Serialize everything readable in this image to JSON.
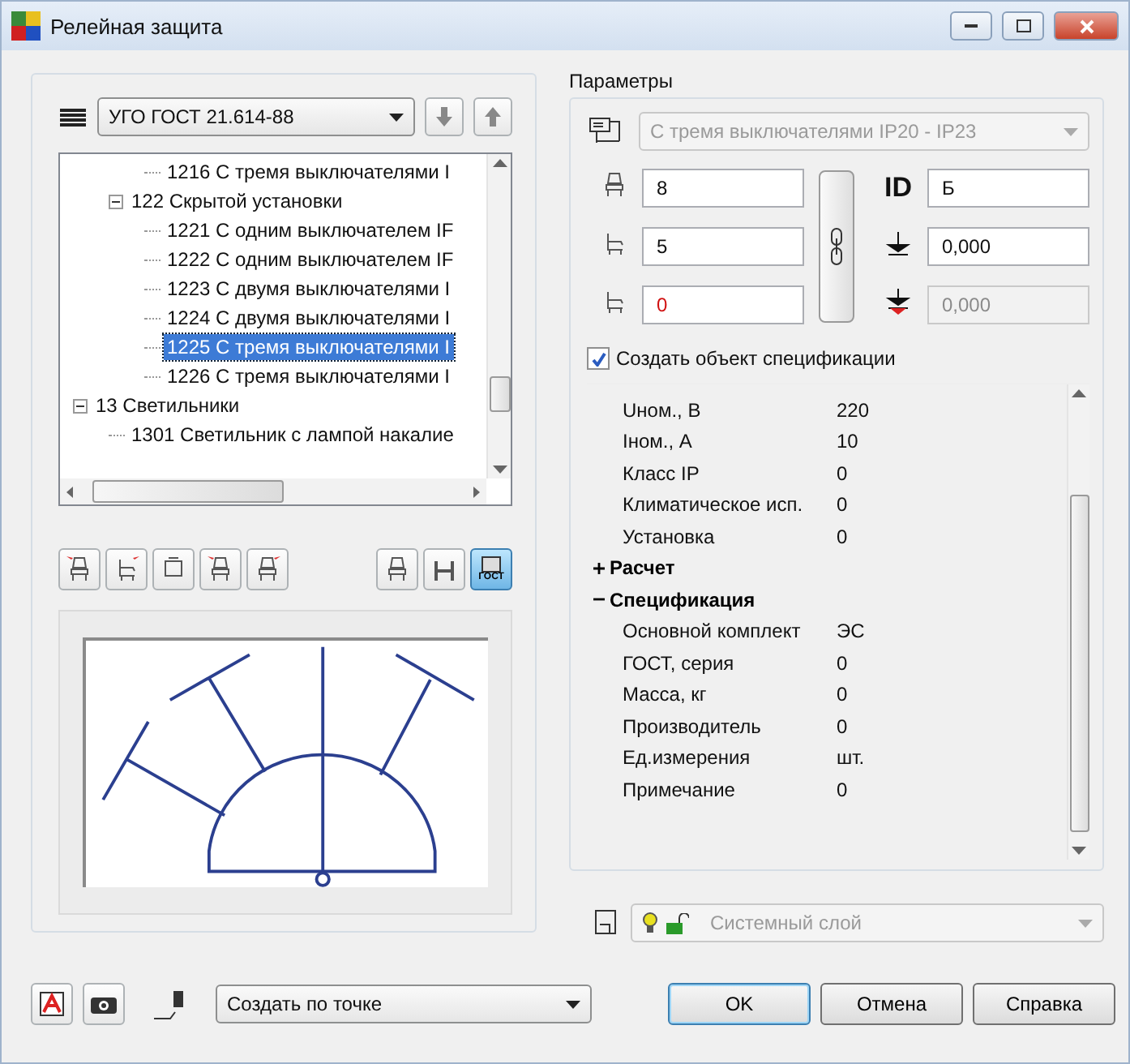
{
  "window": {
    "title": "Релейная защита"
  },
  "library": {
    "value": "УГО ГОСТ 21.614-88"
  },
  "tree": {
    "items": [
      {
        "children": [
          {
            "children": [
              {
                "label": "1216 С тремя выключателями I",
                "selected": false
              }
            ]
          },
          {
            "label": "122 Скрытой установки",
            "expanded": true,
            "selected": false,
            "children": [
              {
                "label": "1221 С одним выключателем IF",
                "selected": false
              },
              {
                "label": "1222 С одним выключателем IF",
                "selected": false
              },
              {
                "label": "1223 С двумя выключателями I",
                "selected": false
              },
              {
                "label": "1224 С двумя выключателями I",
                "selected": false
              },
              {
                "label": "1225 С тремя выключателями I",
                "selected": true
              },
              {
                "label": "1226 С тремя выключателями I",
                "selected": false
              }
            ]
          }
        ]
      },
      {
        "label": "13 Светильники",
        "expanded": true,
        "selected": false,
        "children": [
          {
            "label": "1301 Светильник с лампой накалие",
            "selected": false
          }
        ]
      }
    ]
  },
  "symbol_modes": [
    {
      "kind": "seat",
      "selected": false
    },
    {
      "kind": "bracket",
      "selected": false
    },
    {
      "kind": "gost",
      "label": "ГОСТ",
      "selected": true
    }
  ],
  "parameters": {
    "title": "Параметры",
    "type_combo": {
      "value": "С тремя выключателями IP20 - IP23",
      "disabled": true
    },
    "fields_left": [
      {
        "kind": "width",
        "value": "8",
        "error": false
      },
      {
        "kind": "depth",
        "value": "5",
        "error": false
      },
      {
        "kind": "height",
        "value": "0",
        "error": true
      }
    ],
    "fields_right": [
      {
        "kind": "id",
        "label": "ID",
        "value": "Б",
        "disabled": false
      },
      {
        "kind": "level",
        "value": "0,000",
        "disabled": false
      },
      {
        "kind": "offset",
        "value": "0,000",
        "disabled": true
      }
    ],
    "create_spec": {
      "label": "Создать объект спецификации",
      "checked": true
    },
    "properties": [
      {
        "children": [
          {
            "name": "Uном., В",
            "value": "220"
          },
          {
            "name": "Iном., А",
            "value": "10"
          },
          {
            "name": "Класс IP",
            "value": "0"
          },
          {
            "name": "Климатическое исп.",
            "value": "0"
          },
          {
            "name": "Установка",
            "value": "0"
          }
        ]
      },
      {
        "label": "Расчет",
        "expanded": false
      },
      {
        "label": "Спецификация",
        "expanded": true,
        "children": [
          {
            "name": "Основной комплект",
            "value": "ЭС"
          },
          {
            "name": "ГОСТ, серия",
            "value": "0"
          },
          {
            "name": "Масса, кг",
            "value": "0"
          },
          {
            "name": "Производитель",
            "value": "0"
          },
          {
            "name": "Ед.измерения",
            "value": "шт."
          },
          {
            "name": "Примечание",
            "value": "0"
          }
        ]
      }
    ]
  },
  "layer": {
    "value": "Системный слой",
    "disabled": true
  },
  "placement": {
    "value": "Создать по точке"
  },
  "buttons": [
    {
      "label": "OK",
      "default": true
    },
    {
      "label": "Отмена",
      "default": false
    },
    {
      "label": "Справка",
      "default": false
    }
  ]
}
